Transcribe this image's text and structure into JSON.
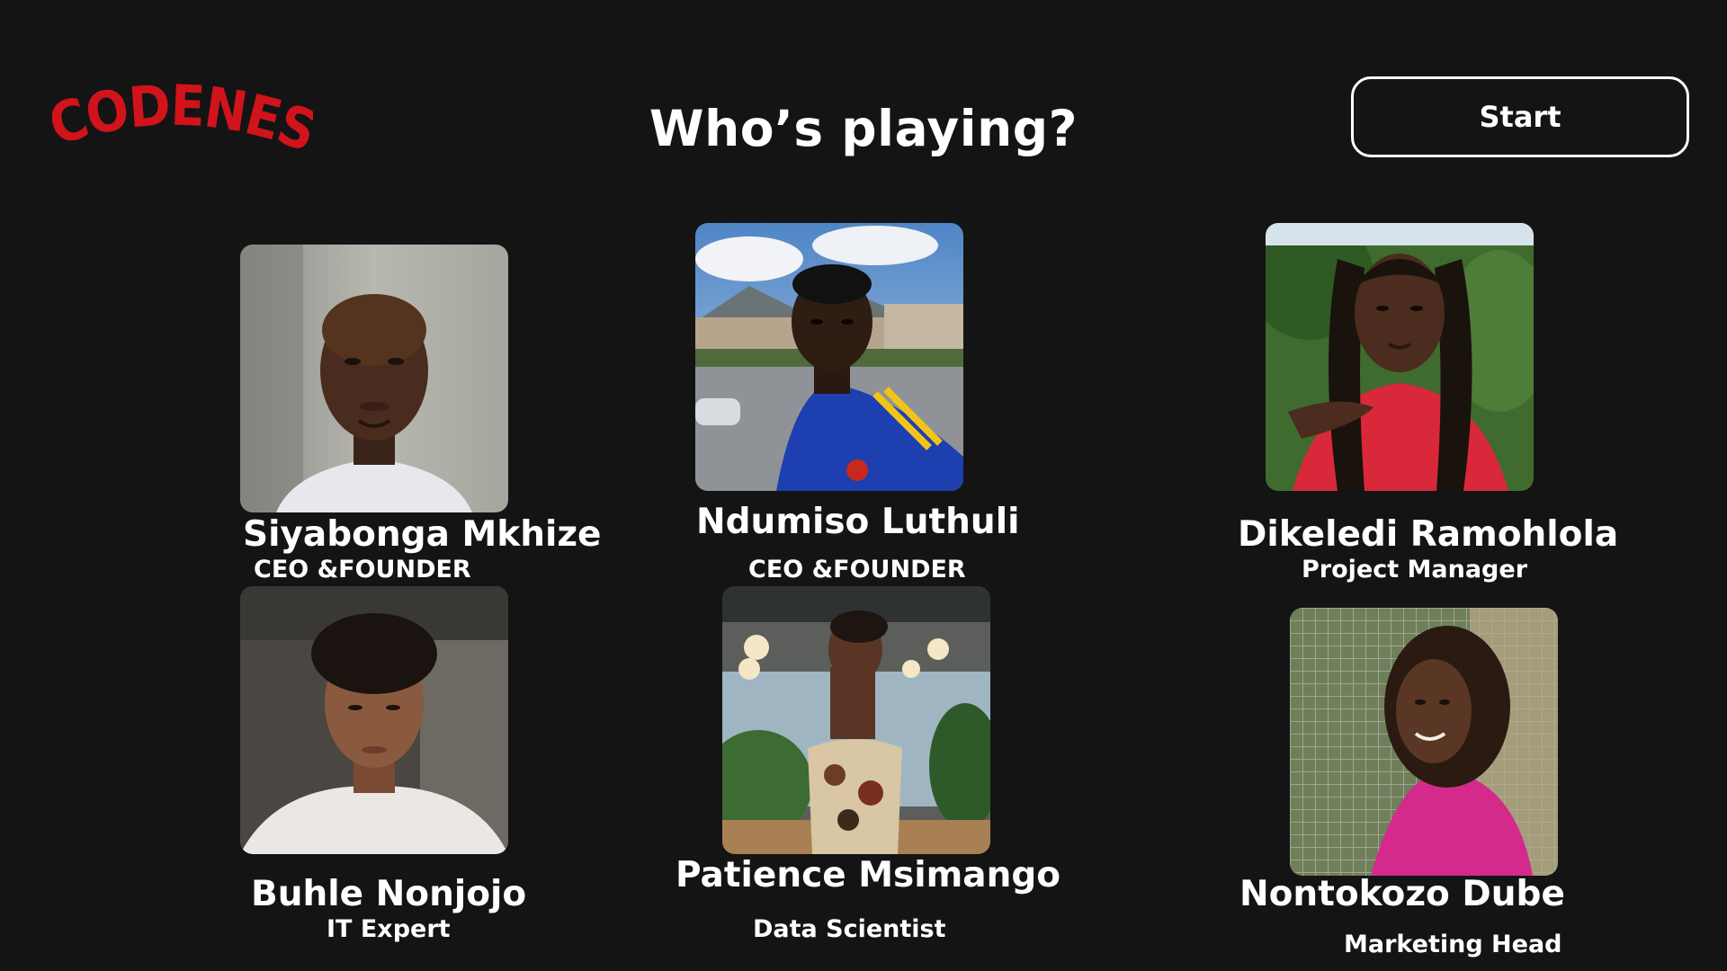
{
  "app": {
    "logo_text": "CODENEST",
    "brand_color": "#d1131c",
    "background_color": "#141414"
  },
  "header": {
    "title": "Who’s playing?",
    "start_label": "Start"
  },
  "profiles": [
    {
      "name": "Siyabonga Mkhize",
      "role": "CEO &FOUNDER",
      "photo": "man-portrait-light-wall"
    },
    {
      "name": "Ndumiso Luthuli",
      "role": "CEO &FOUNDER",
      "photo": "man-outdoor-blue-jersey"
    },
    {
      "name": "Dikeledi Ramohlola",
      "role": "Project Manager",
      "photo": "woman-braids-red-top"
    },
    {
      "name": "Buhle Nonjojo",
      "role": "IT Expert",
      "photo": "woman-portrait-white-robe"
    },
    {
      "name": "Patience Msimango",
      "role": "Data Scientist",
      "photo": "woman-corset-indoor"
    },
    {
      "name": "Nontokozo Dube",
      "role": "Marketing Head",
      "photo": "woman-curls-pink-top"
    }
  ]
}
